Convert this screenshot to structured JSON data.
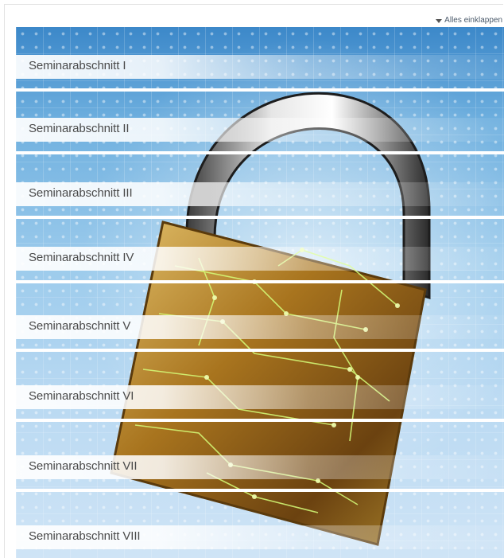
{
  "collapse_all": {
    "label": "Alles einklappen",
    "icon": "triangle-down-icon"
  },
  "sections": [
    {
      "label": "Seminarabschnitt I"
    },
    {
      "label": "Seminarabschnitt II"
    },
    {
      "label": "Seminarabschnitt III"
    },
    {
      "label": "Seminarabschnitt IV"
    },
    {
      "label": "Seminarabschnitt V"
    },
    {
      "label": "Seminarabschnitt VI"
    },
    {
      "label": "Seminarabschnitt VII"
    },
    {
      "label": "Seminarabschnitt VIII"
    }
  ],
  "colors": {
    "sky": "#6fb0df",
    "lock_gold": "#b8860b",
    "circuit_glow": "#d6ff7a"
  }
}
